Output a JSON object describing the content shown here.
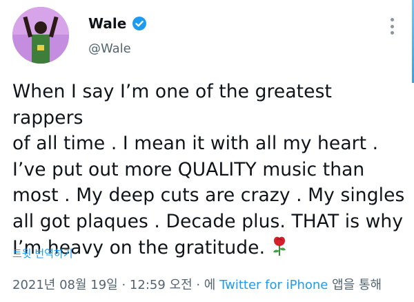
{
  "author": {
    "display_name": "Wale",
    "handle": "@Wale",
    "verified": true
  },
  "tweet": {
    "text": "When I say I’m one of the greatest rappers\nof all time . I mean it with all my heart .\nI’ve put out more QUALITY music than\nmost . My deep cuts are crazy . My singles\nall got plaques . Decade plus. THAT is why\nI’m heavy on the gratitude.",
    "emoji": "rose-icon"
  },
  "translate_label": "트윗 번역하기",
  "meta": {
    "date": "2021년 08월 19일",
    "sep1": " · ",
    "time": "12:59 오전",
    "sep2": " · 에 ",
    "source": "Twitter for iPhone",
    "suffix": " 앱을 통해"
  },
  "colors": {
    "accent": "#1d9bf0",
    "text": "#0f1419",
    "muted": "#536471"
  }
}
